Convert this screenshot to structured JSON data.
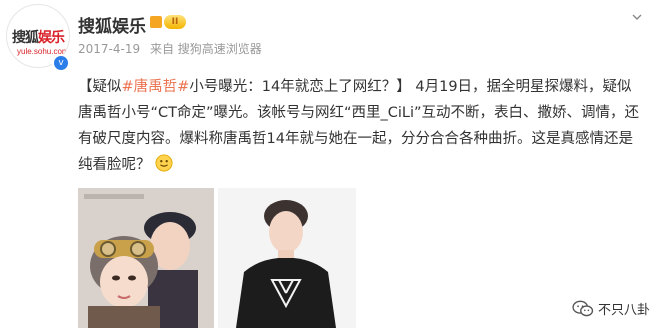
{
  "account": {
    "name": "搜狐娱乐",
    "vip_badge": "II",
    "avatar_text_main": "搜狐",
    "avatar_text_accent": "娱乐",
    "avatar_text_sub": "yule.sohu.com",
    "verified_mark": "v"
  },
  "meta": {
    "date": "2017-4-19",
    "source": "来自 搜狗高速浏览器"
  },
  "post": {
    "open_bracket": "【",
    "lead_text": "疑似",
    "hashtag": "#唐禹哲#",
    "headline_rest": "小号曝光：14年就恋上了网红？】",
    "body": "4月19日，据全明星探爆料，疑似唐禹哲小号“CT命定”曝光。该帐号与网红“西里_CiLi”互动不断，表白、撒娇、调情，还有破尺度内容。爆料称唐禹哲14年就与她在一起，分分合合各种曲折。这是真感情还是纯看脸呢？"
  },
  "images": [
    {
      "name": "photo-couple-selfie"
    },
    {
      "name": "photo-man-black-tshirt"
    }
  ],
  "watermark": {
    "text": "不只八卦",
    "icon": "wechat-icon"
  },
  "colors": {
    "hashtag": "#eb7350",
    "verified": "#2b7de9",
    "vip": "#f3b400"
  }
}
